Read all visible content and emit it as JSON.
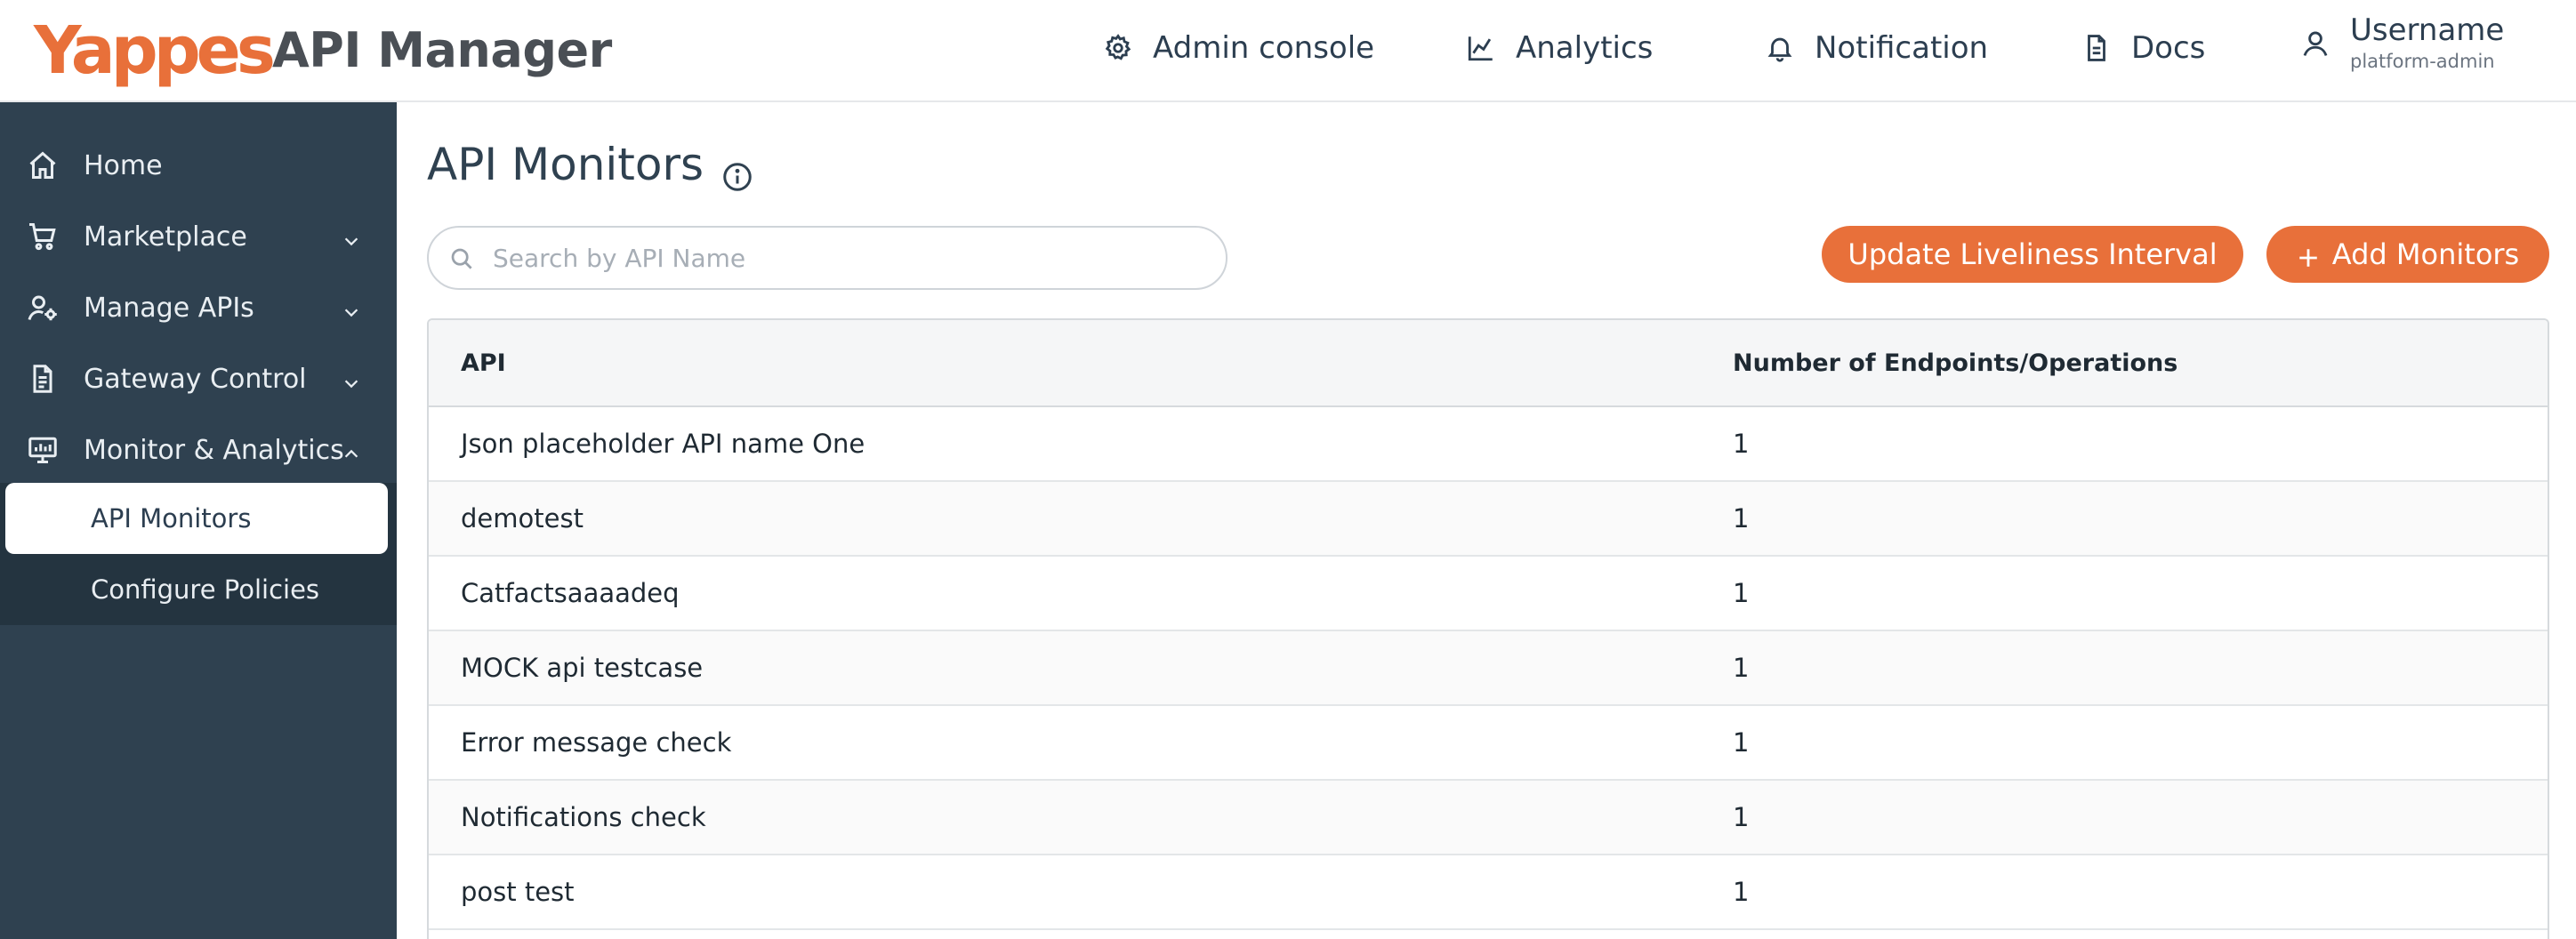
{
  "brand": {
    "logo_text": "Yappes",
    "app_name": "API Manager",
    "accent": "#e8703a"
  },
  "nav": {
    "admin_console": "Admin console",
    "analytics": "Analytics",
    "notification": "Notification",
    "docs": "Docs",
    "username": "Username",
    "role": "platform-admin"
  },
  "sidebar": {
    "items": [
      {
        "label": "Home",
        "icon": "home-icon"
      },
      {
        "label": "Marketplace",
        "icon": "cart-icon"
      },
      {
        "label": "Manage APIs",
        "icon": "user-gear-icon"
      },
      {
        "label": "Gateway Control",
        "icon": "document-icon"
      },
      {
        "label": "Monitor & Analytics",
        "icon": "monitor-icon"
      }
    ],
    "subitems": [
      {
        "label": "API Monitors",
        "active": true
      },
      {
        "label": "Configure Policies",
        "active": false
      }
    ]
  },
  "main": {
    "title": "API Monitors",
    "search_placeholder": "Search by API Name",
    "update_button": "Update Liveliness Interval",
    "add_button": "Add Monitors",
    "table": {
      "headers": [
        "API",
        "Number of Endpoints/Operations"
      ],
      "rows": [
        [
          "Json placeholder API name One",
          "1"
        ],
        [
          "demotest",
          "1"
        ],
        [
          "Catfactsaaaadeq",
          "1"
        ],
        [
          "MOCK api testcase",
          "1"
        ],
        [
          "Error message check",
          "1"
        ],
        [
          "Notifications check",
          "1"
        ],
        [
          "post test",
          "1"
        ]
      ]
    }
  }
}
